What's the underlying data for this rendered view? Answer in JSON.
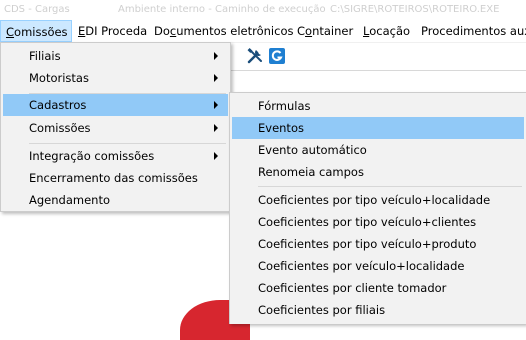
{
  "window": {
    "title_parts": [
      "CDS - Cargas",
      "Ambiente interno - Caminho de execução",
      "C:\\SIGRE\\ROTEIROS\\ROTEIRO.EXE"
    ]
  },
  "menubar": {
    "items": [
      {
        "label": "Comissões",
        "mnemonic": "C",
        "active": true
      },
      {
        "label": "EDI Proceda",
        "mnemonic": "E"
      },
      {
        "label": "Documentos eletrônicos",
        "mnemonic": "c"
      },
      {
        "label": "Container",
        "mnemonic": "o"
      },
      {
        "label": "Locação",
        "mnemonic": "L"
      },
      {
        "label": "Procedimentos auxi"
      }
    ]
  },
  "toolbar": {
    "icons": [
      "tools-icon",
      "refresh-g-icon"
    ]
  },
  "menu_main": {
    "items": [
      {
        "label": "Filiais",
        "submenu": true
      },
      {
        "label": "Motoristas",
        "submenu": true
      },
      {
        "label": "Cadastros",
        "submenu": true,
        "highlighted": true
      },
      {
        "label": "Comissões",
        "submenu": true
      },
      {
        "label": "Integração comissões",
        "submenu": true
      },
      {
        "label": "Encerramento das comissões",
        "submenu": false
      },
      {
        "label": "Agendamento",
        "submenu": false
      }
    ]
  },
  "menu_cadastros": {
    "items": [
      {
        "label": "Fórmulas"
      },
      {
        "label": "Eventos",
        "highlighted": true
      },
      {
        "label": "Evento automático"
      },
      {
        "label": "Renomeia campos"
      },
      {
        "label": "Coeficientes por tipo veículo+localidade"
      },
      {
        "label": "Coeficientes por tipo veículo+clientes"
      },
      {
        "label": "Coeficientes por tipo veículo+produto"
      },
      {
        "label": "Coeficientes por veículo+localidade"
      },
      {
        "label": "Coeficientes por cliente tomador"
      },
      {
        "label": "Coeficientes por filiais"
      }
    ]
  },
  "colors": {
    "menu_highlight": "#91c9f7",
    "menubar_active": "#cce8ff",
    "menu_background": "#f2f2f2"
  }
}
